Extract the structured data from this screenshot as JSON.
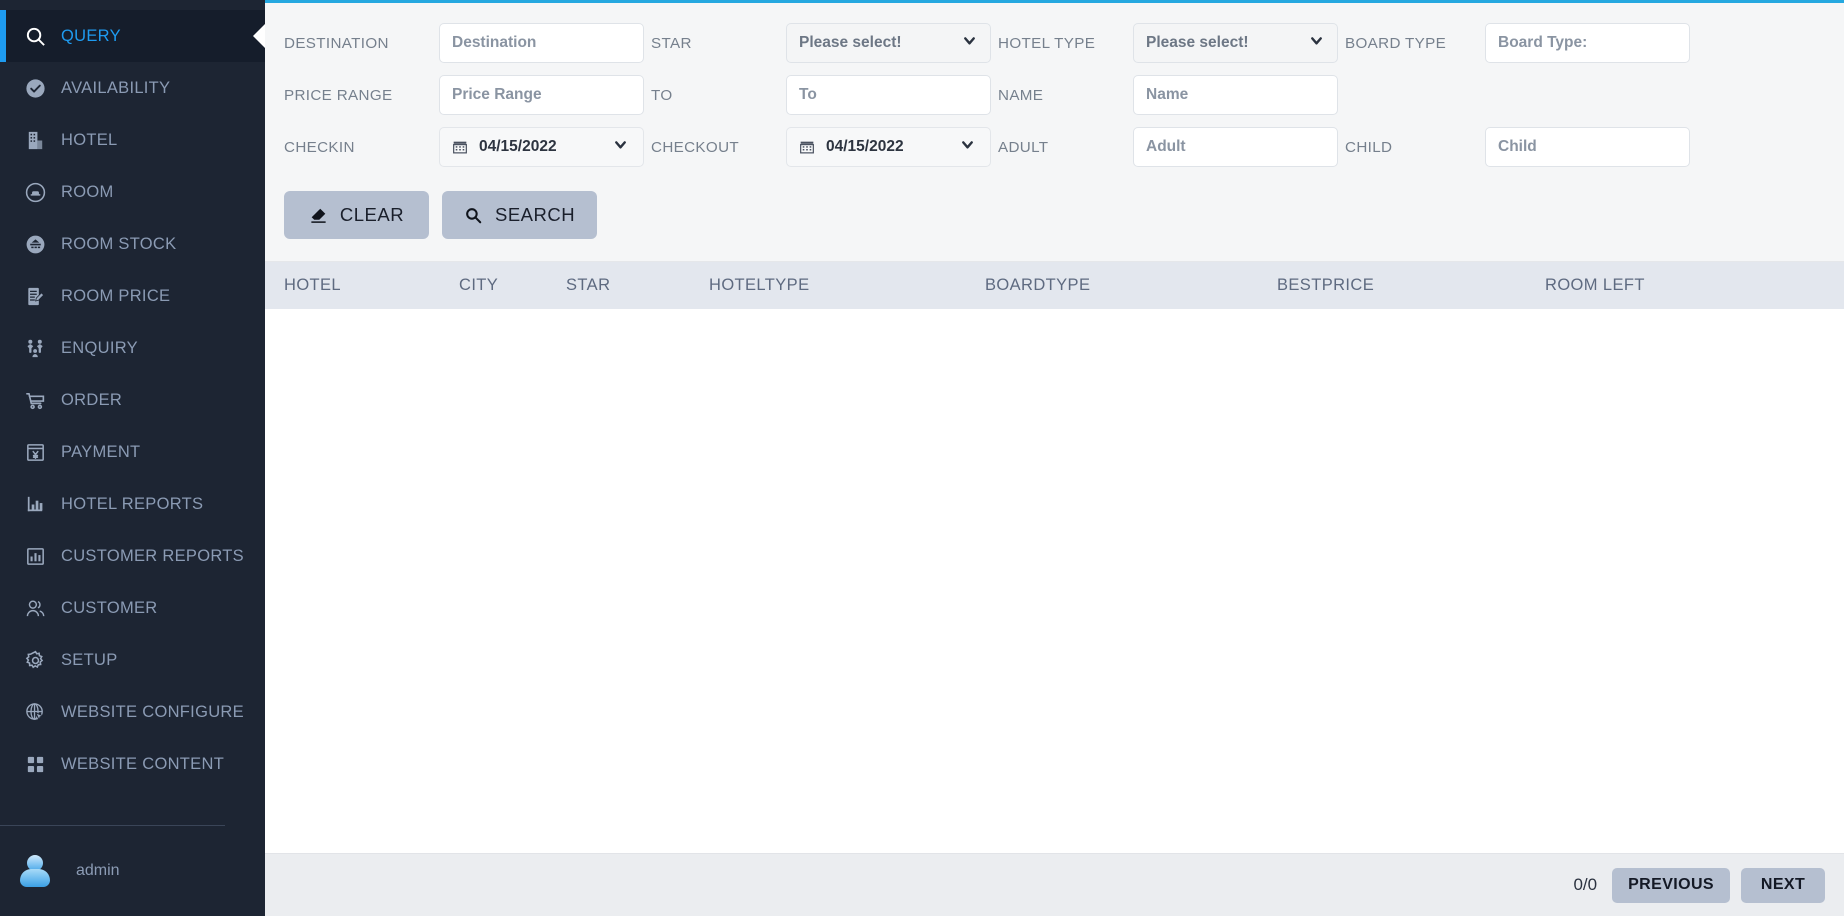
{
  "sidebar": {
    "items": [
      {
        "label": "QUERY",
        "icon": "search-icon",
        "active": true
      },
      {
        "label": "AVAILABILITY",
        "icon": "check-circle-icon",
        "active": false
      },
      {
        "label": "HOTEL",
        "icon": "building-icon",
        "active": false
      },
      {
        "label": "ROOM",
        "icon": "bed-circle-icon",
        "active": false
      },
      {
        "label": "ROOM STOCK",
        "icon": "stock-circle-icon",
        "active": false
      },
      {
        "label": "ROOM PRICE",
        "icon": "clipboard-edit-icon",
        "active": false
      },
      {
        "label": "ENQUIRY",
        "icon": "people-icon",
        "active": false
      },
      {
        "label": "ORDER",
        "icon": "shopping-cart-icon",
        "active": false
      },
      {
        "label": "PAYMENT",
        "icon": "payment-yen-icon",
        "active": false
      },
      {
        "label": "HOTEL REPORTS",
        "icon": "bar-chart-icon",
        "active": false
      },
      {
        "label": "CUSTOMER REPORTS",
        "icon": "chart-box-icon",
        "active": false
      },
      {
        "label": "CUSTOMER",
        "icon": "users-icon",
        "active": false
      },
      {
        "label": "SETUP",
        "icon": "gear-icon",
        "active": false
      },
      {
        "label": "WEBSITE CONFIGURE",
        "icon": "globe-cursor-icon",
        "active": false
      },
      {
        "label": "WEBSITE CONTENT",
        "icon": "grid-squares-icon",
        "active": false
      }
    ],
    "user": {
      "name": "admin",
      "avatar_icon": "user-avatar-icon"
    },
    "accent_color": "#1e9bf0",
    "background_color": "#1d2533"
  },
  "filters": {
    "destination": {
      "label": "DESTINATION",
      "placeholder": "Destination",
      "value": ""
    },
    "star": {
      "label": "STAR",
      "selected": "Please select!"
    },
    "hotel_type": {
      "label": "HOTEL TYPE",
      "selected": "Please select!"
    },
    "board_type": {
      "label": "BOARD TYPE",
      "placeholder": "Board Type:",
      "value": ""
    },
    "price_range": {
      "label": "PRICE RANGE",
      "placeholder": "Price Range",
      "value": ""
    },
    "to": {
      "label": "TO",
      "placeholder": "To",
      "value": ""
    },
    "name": {
      "label": "NAME",
      "placeholder": "Name",
      "value": ""
    },
    "checkin": {
      "label": "CHECKIN",
      "value": "04/15/2022",
      "icon": "calendar-icon"
    },
    "checkout": {
      "label": "CHECKOUT",
      "value": "04/15/2022",
      "icon": "calendar-icon"
    },
    "adult": {
      "label": "ADULT",
      "placeholder": "Adult",
      "value": ""
    },
    "child": {
      "label": "CHILD",
      "placeholder": "Child",
      "value": ""
    }
  },
  "actions": {
    "clear": {
      "label": "CLEAR",
      "icon": "eraser-icon"
    },
    "search": {
      "label": "SEARCH",
      "icon": "search-icon"
    }
  },
  "table": {
    "columns": [
      "HOTEL",
      "CITY",
      "STAR",
      "HOTELTYPE",
      "BOARDTYPE",
      "BESTPRICE",
      "ROOM LEFT"
    ],
    "rows": []
  },
  "pagination": {
    "count": "0/0",
    "previous_label": "PREVIOUS",
    "next_label": "NEXT"
  },
  "theme": {
    "top_accent": "#25a8e0",
    "button_bg": "#b5bfd0",
    "table_header_bg": "#e3e7ee"
  }
}
